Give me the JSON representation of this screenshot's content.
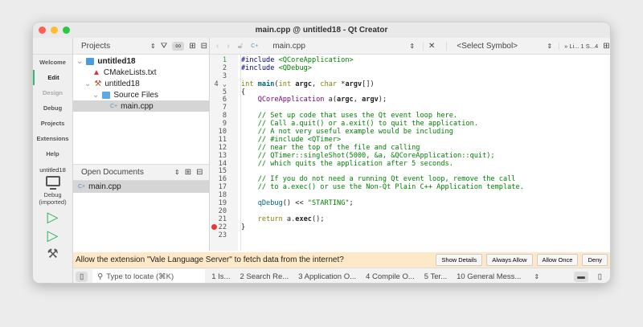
{
  "window": {
    "title": "main.cpp @ untitled18 - Qt Creator"
  },
  "modes": [
    "Welcome",
    "Edit",
    "Design",
    "Debug",
    "Projects",
    "Extensions",
    "Help"
  ],
  "kit": {
    "project": "untitled18",
    "config": "Debug",
    "config2": "(imported)"
  },
  "projects": {
    "label": "Projects",
    "tree": [
      "untitled18",
      "CMakeLists.txt",
      "untitled18",
      "Source Files",
      "main.cpp"
    ]
  },
  "open_docs": {
    "label": "Open Documents",
    "items": [
      "main.cpp"
    ]
  },
  "editor": {
    "file": "main.cpp",
    "symbol": "<Select Symbol>",
    "position": "» Li... 1 S...4"
  },
  "code": [
    "#include <QCoreApplication>",
    "#include <QDebug>",
    "",
    "int main(int argc, char *argv[])",
    "{",
    "    QCoreApplication a(argc, argv);",
    "",
    "    // Set up code that uses the Qt event loop here.",
    "    // Call a.quit() or a.exit() to quit the application.",
    "    // A not very useful example would be including",
    "    // #include <QTimer>",
    "    // near the top of the file and calling",
    "    // QTimer::singleShot(5000, &a, &QCoreApplication::quit);",
    "    // which quits the application after 5 seconds.",
    "",
    "    // If you do not need a running Qt event loop, remove the call",
    "    // to a.exec() or use the Non-Qt Plain C++ Application template.",
    "",
    "    qDebug() << \"STARTING\";",
    "",
    "    return a.exec();",
    "}",
    ""
  ],
  "info": {
    "message": "Allow the extension \"Vale Language Server\" to fetch data from the internet?",
    "buttons": [
      "Show Details",
      "Always Allow",
      "Allow Once",
      "Deny"
    ]
  },
  "status": {
    "locate_placeholder": "Type to locate (⌘K)",
    "tabs": [
      "1  Is...",
      "2  Search Re...",
      "3  Application O...",
      "4  Compile O...",
      "5  Ter...",
      "10  General Mess..."
    ]
  }
}
